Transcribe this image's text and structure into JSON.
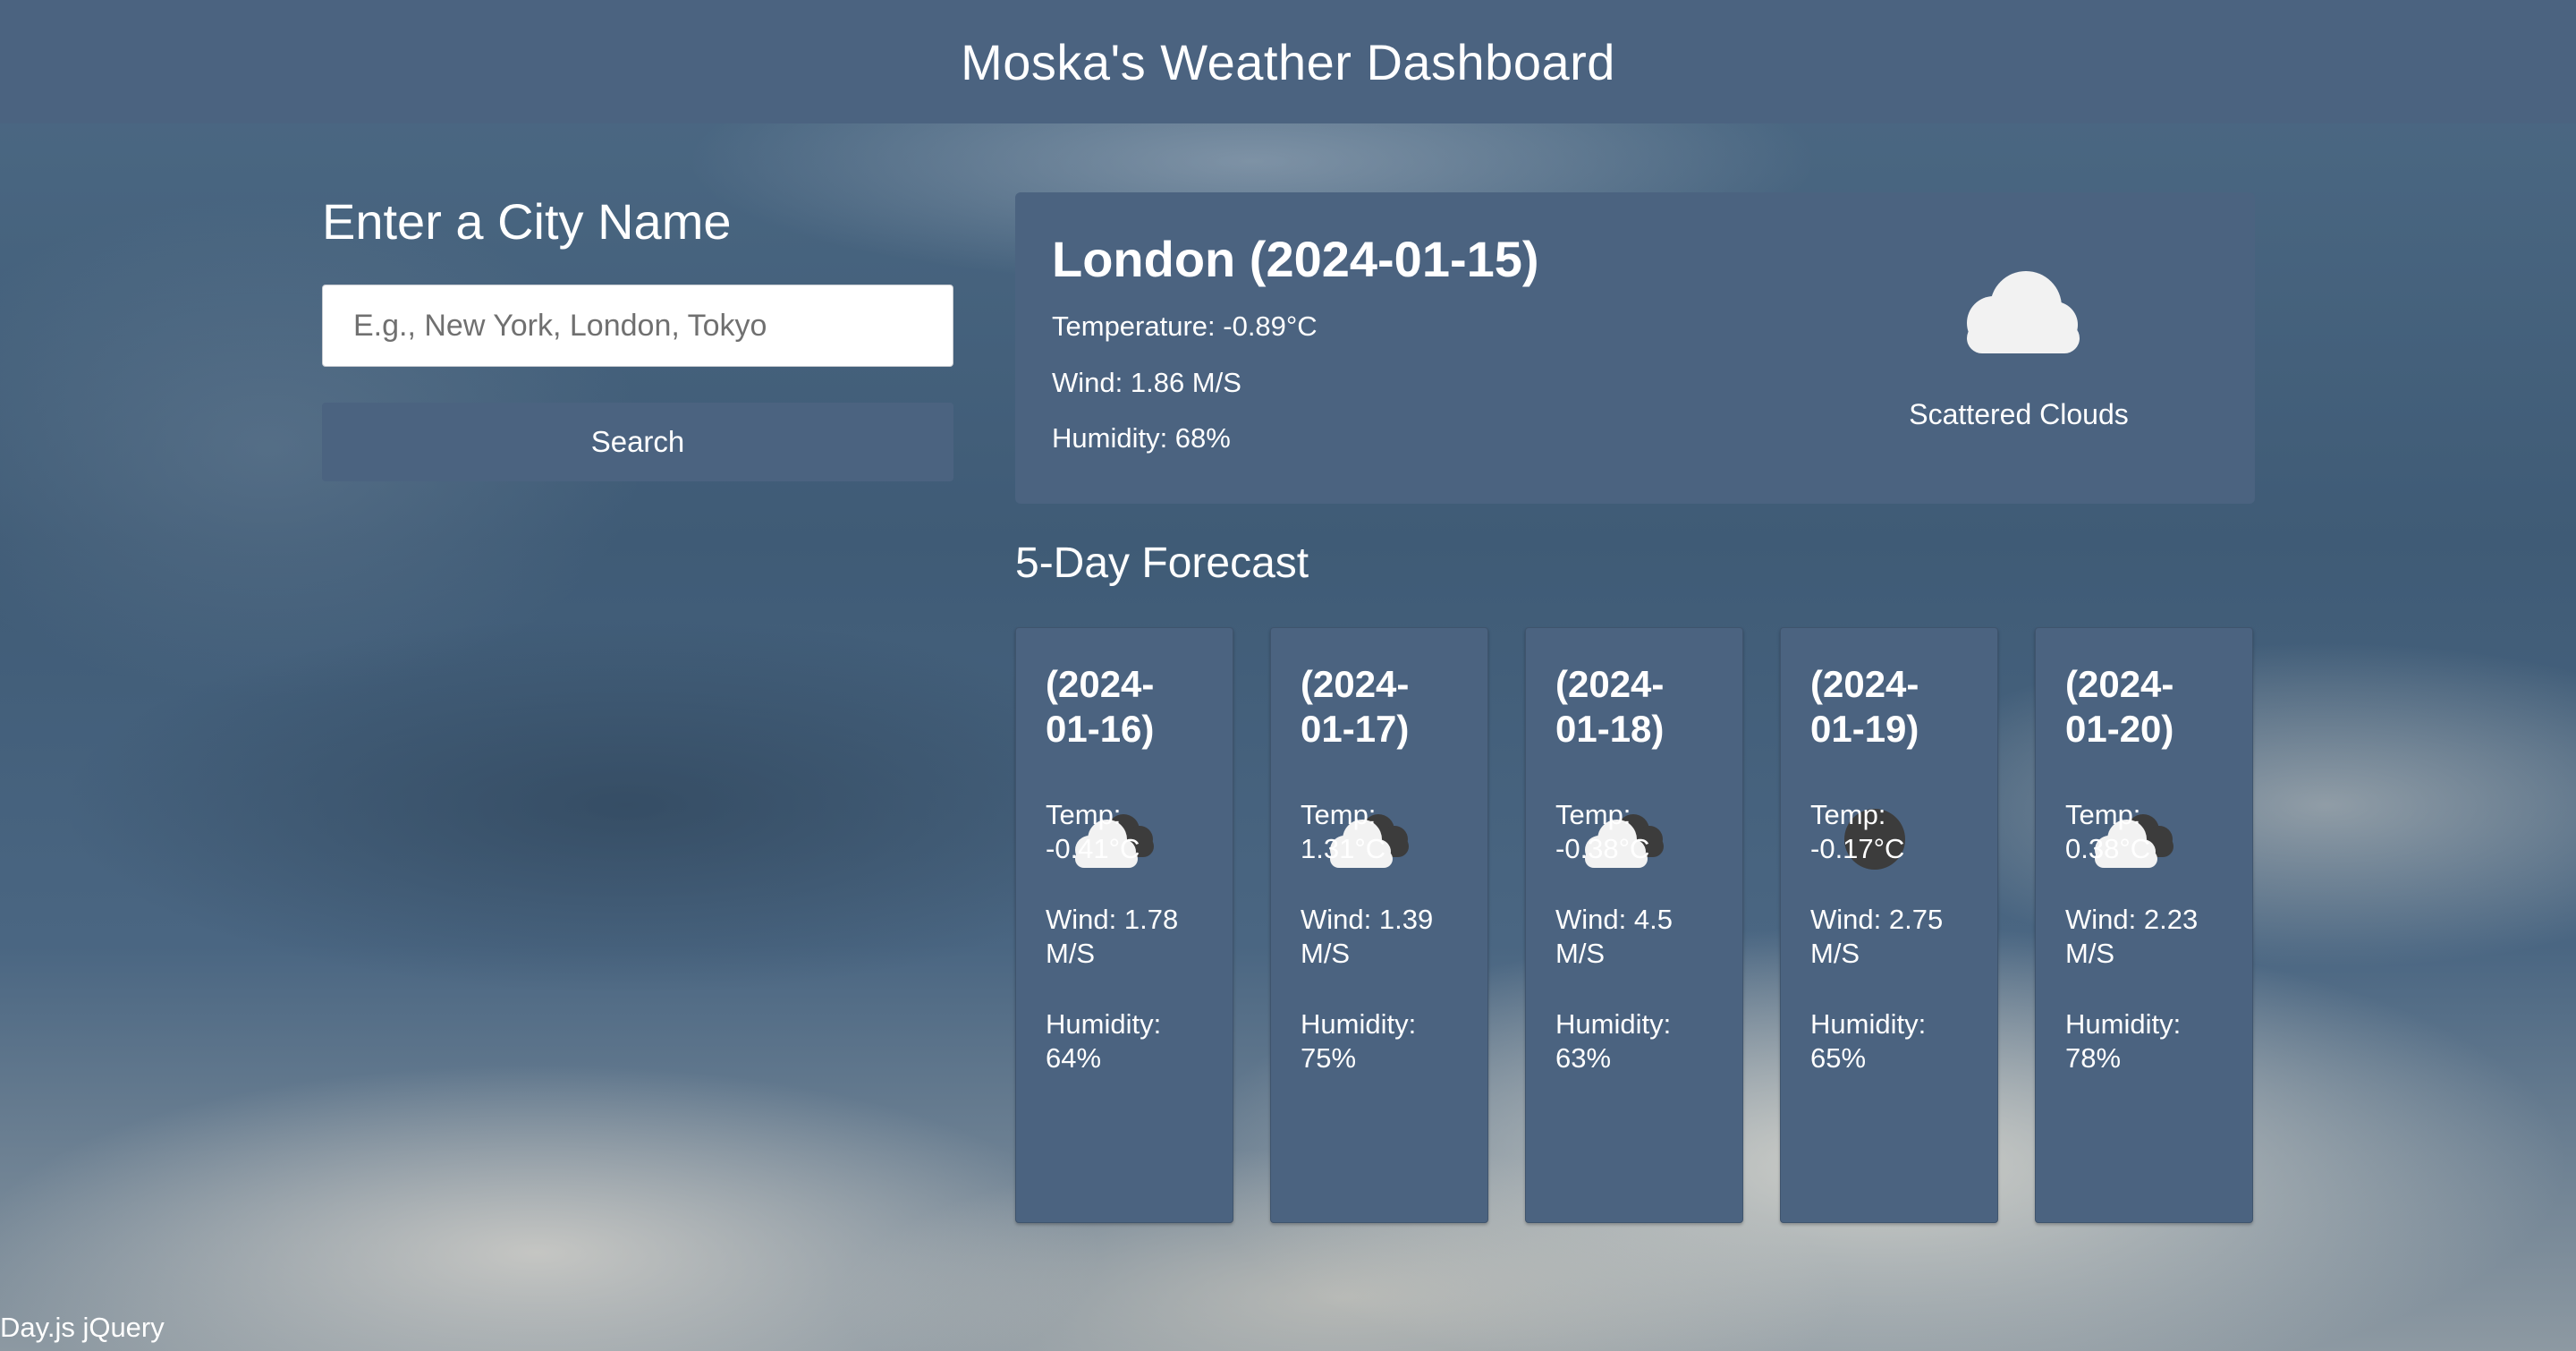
{
  "header": {
    "title": "Moska's Weather Dashboard"
  },
  "search": {
    "heading": "Enter a City Name",
    "placeholder": "E.g., New York, London, Tokyo",
    "value": "",
    "button_label": "Search"
  },
  "current": {
    "title": "London (2024-01-15)",
    "temperature": "Temperature: -0.89°C",
    "wind": "Wind: 1.86 M/S",
    "humidity": "Humidity: 68%",
    "description": "Scattered Clouds",
    "icon": "scattered-clouds-icon"
  },
  "forecast": {
    "title": "5-Day Forecast",
    "days": [
      {
        "date_line1": "(2024-",
        "date_line2": "01-16)",
        "icon": "broken-clouds-icon",
        "temp_label": "Temp:",
        "temp": "-0.41°C",
        "wind_label": "Wind: 1.78",
        "wind_unit": "M/S",
        "humidity_label": "Humidity:",
        "humidity": "64%"
      },
      {
        "date_line1": "(2024-",
        "date_line2": "01-17)",
        "icon": "broken-clouds-icon",
        "temp_label": "Temp:",
        "temp": "1.31°C",
        "wind_label": "Wind: 1.39",
        "wind_unit": "M/S",
        "humidity_label": "Humidity:",
        "humidity": "75%"
      },
      {
        "date_line1": "(2024-",
        "date_line2": "01-18)",
        "icon": "broken-clouds-icon",
        "temp_label": "Temp:",
        "temp": "-0.38°C",
        "wind_label": "Wind: 4.5",
        "wind_unit": "M/S",
        "humidity_label": "Humidity:",
        "humidity": "63%"
      },
      {
        "date_line1": "(2024-",
        "date_line2": "01-19)",
        "icon": "overcast-clouds-icon",
        "temp_label": "Temp:",
        "temp": "-0.17°C",
        "wind_label": "Wind: 2.75",
        "wind_unit": "M/S",
        "humidity_label": "Humidity:",
        "humidity": "65%"
      },
      {
        "date_line1": "(2024-",
        "date_line2": "01-20)",
        "icon": "broken-clouds-icon",
        "temp_label": "Temp:",
        "temp": "0.38°C",
        "wind_label": "Wind: 2.23",
        "wind_unit": "M/S",
        "humidity_label": "Humidity:",
        "humidity": "78%"
      }
    ]
  },
  "footer": {
    "text": "Day.js jQuery"
  },
  "colors": {
    "panel": "#4b6380",
    "text": "#ffffff",
    "cloud_light": "#f2f2f2",
    "cloud_dark": "#3c3c3c"
  }
}
